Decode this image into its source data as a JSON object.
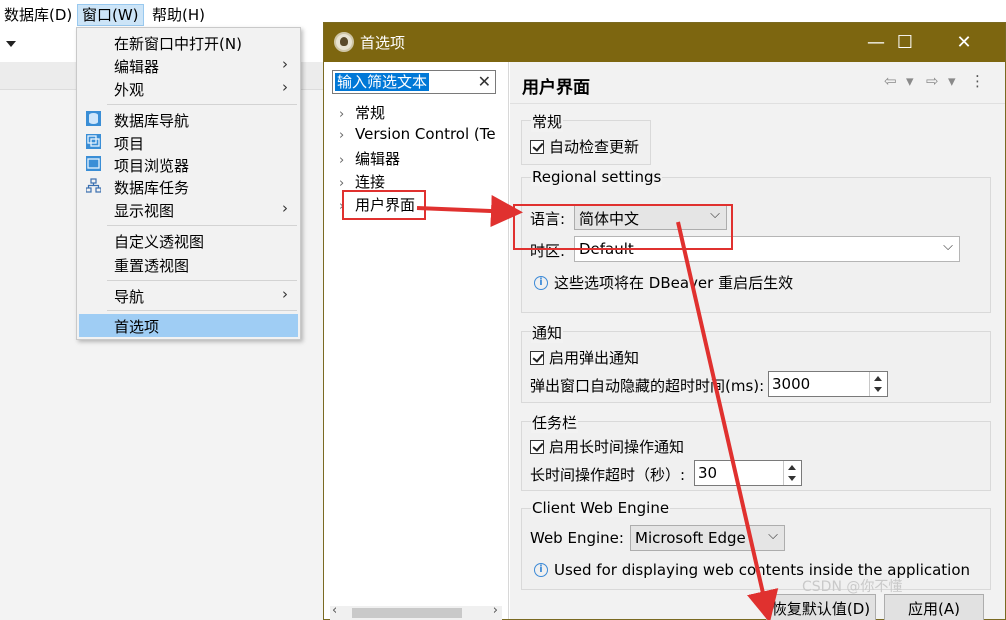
{
  "menubar": {
    "items": [
      {
        "label": "数据库(D)"
      },
      {
        "label": "窗口(W)"
      },
      {
        "label": "帮助(H)"
      }
    ]
  },
  "window_menu": {
    "items": [
      {
        "label": "在新窗口中打开(N)"
      },
      {
        "label": "编辑器",
        "submenu_arrow": "›"
      },
      {
        "label": "外观",
        "submenu_arrow": "›"
      },
      {
        "label": "数据库导航",
        "icon": "database-navigator-icon"
      },
      {
        "label": "项目",
        "icon": "projects-icon"
      },
      {
        "label": "项目浏览器",
        "icon": "project-explorer-icon"
      },
      {
        "label": "数据库任务",
        "icon": "database-tasks-icon"
      },
      {
        "label": "显示视图",
        "submenu_arrow": "›"
      },
      {
        "label": "自定义透视图"
      },
      {
        "label": "重置透视图"
      },
      {
        "label": "导航",
        "submenu_arrow": "›"
      },
      {
        "label": "首选项",
        "selected": true
      }
    ]
  },
  "dialog": {
    "title": "首选项",
    "minimize": "—",
    "maximize": "☐",
    "close": "✕",
    "filter": {
      "value": "输入筛选文本",
      "clear": "✕"
    },
    "tree": [
      {
        "label": "常规",
        "chev": "›"
      },
      {
        "label": "Version Control (Te",
        "chev": "›"
      },
      {
        "label": "编辑器",
        "chev": "›"
      },
      {
        "label": "连接",
        "chev": "›"
      },
      {
        "label": "用户界面",
        "chev": "›",
        "selected": true
      }
    ],
    "scroll_left": "‹",
    "scroll_right": "›",
    "page": {
      "title": "用户界面",
      "nav_back": "⇦",
      "nav_back_menu": "▾",
      "nav_forward": "⇨",
      "nav_forward_menu": "▾",
      "view_menu": "⋮",
      "general": {
        "title": "常规",
        "auto_update_label": "自动检查更新",
        "auto_update_checked": true
      },
      "regional": {
        "title": "Regional settings",
        "language_label": "语言:",
        "language_value": "简体中文",
        "timezone_label": "时区:",
        "timezone_value": "Default",
        "restart_note": "这些选项将在 DBeaver 重启后生效"
      },
      "notifications": {
        "title": "通知",
        "popup_label": "启用弹出通知",
        "popup_checked": true,
        "timeout_label": "弹出窗口自动隐藏的超时时间(ms):",
        "timeout_value": "3000"
      },
      "taskbar": {
        "title": "任务栏",
        "long_op_label": "启用长时间操作通知",
        "long_op_checked": true,
        "long_op_timeout_label": "长时间操作超时（秒）:",
        "long_op_timeout_value": "30"
      },
      "web_engine": {
        "title": "Client Web Engine",
        "engine_label": "Web Engine:",
        "engine_value": "Microsoft Edge",
        "note": "Used for displaying web contents inside the application"
      },
      "buttons": {
        "restore_defaults": "恢复默认值(D)",
        "apply": "应用(A)"
      }
    },
    "watermark": "CSDN @你不懂"
  },
  "colors": {
    "titlebar": "#7d6610",
    "menu_selected": "#9fcdf4",
    "annotation_red": "#e0312f"
  }
}
